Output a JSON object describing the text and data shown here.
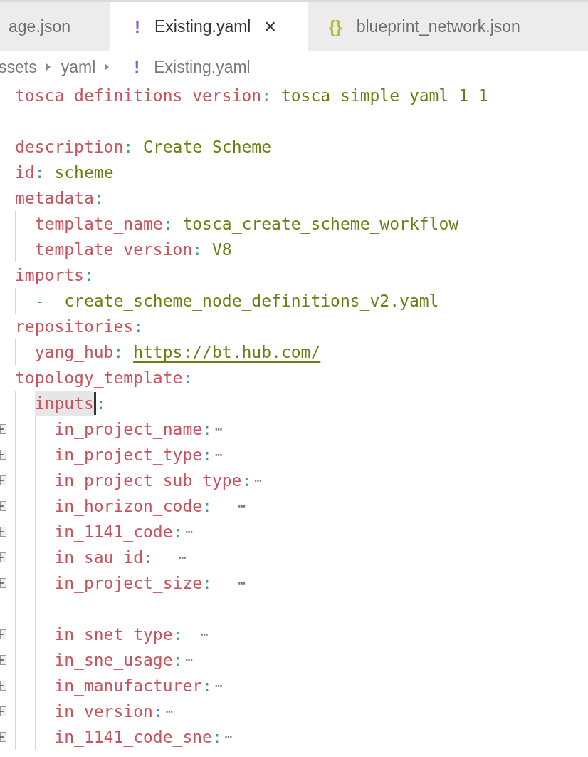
{
  "tabs": [
    {
      "label": "age.json",
      "selected": false
    },
    {
      "label": "Existing.yaml",
      "selected": true,
      "icon": "!",
      "color": "#8e5cc0",
      "close": "✕"
    },
    {
      "label": "blueprint_network.json",
      "selected": false,
      "icon": "{}",
      "color": "#b5ba3a"
    }
  ],
  "breadcrumb": [
    {
      "label": "ssets"
    },
    {
      "label": "yaml"
    },
    {
      "label": "Existing.yaml",
      "icon": "!",
      "color": "#8e5cc0"
    }
  ],
  "lines": [
    {
      "kind": "pair",
      "key": "tosca_definitions_version",
      "colon": ":",
      "value": "tosca_simple_yaml_1_1"
    },
    {
      "kind": "blank"
    },
    {
      "kind": "pair",
      "key": "description",
      "colon": ":",
      "value": "Create Scheme"
    },
    {
      "kind": "pair",
      "key": "id",
      "colon": ":",
      "value": "scheme"
    },
    {
      "kind": "pair",
      "key": "metadata",
      "colon": ":",
      "children": [
        {
          "kind": "pair",
          "key": "template_name",
          "colon": ":",
          "value": "tosca_create_scheme_workflow"
        },
        {
          "kind": "pair",
          "key": "template_version",
          "colon": ":",
          "value": "V8"
        }
      ]
    },
    {
      "kind": "pair",
      "key": "imports",
      "colon": ":",
      "children": [
        {
          "kind": "item",
          "marker": "-",
          "value": "create_scheme_node_definitions_v2.yaml"
        }
      ]
    },
    {
      "kind": "pair",
      "key": "repositories",
      "colon": ":",
      "children": [
        {
          "kind": "pair",
          "key": "yang_hub",
          "colon": ":",
          "value": "https://bt.hub.com/",
          "link": true
        }
      ]
    },
    {
      "kind": "pair",
      "key": "topology_template",
      "colon": ":",
      "children": [
        {
          "kind": "pair",
          "key": "inputs",
          "colon": ":",
          "highlighted": true,
          "cursor": true,
          "children": [
            {
              "kind": "pair",
              "key": "in_project_name",
              "colon": ":",
              "folded": true,
              "ellipsis": "⋯"
            },
            {
              "kind": "pair",
              "key": "in_project_type",
              "colon": ":",
              "folded": true,
              "ellipsis": "⋯"
            },
            {
              "kind": "pair",
              "key": "in_project_sub_type",
              "colon": ":",
              "folded": true,
              "ellipsis": "⋯"
            },
            {
              "kind": "pair",
              "key": "in_horizon_code",
              "colon": ":",
              "folded": true,
              "ellipsis": "   ⋯"
            },
            {
              "kind": "pair",
              "key": "in_1141_code",
              "colon": ":",
              "folded": true,
              "ellipsis": "⋯"
            },
            {
              "kind": "pair",
              "key": "in_sau_id",
              "colon": ":",
              "folded": true,
              "ellipsis": "   ⋯"
            },
            {
              "kind": "pair",
              "key": "in_project_size",
              "colon": ":",
              "folded": true,
              "ellipsis": "   ⋯"
            },
            {
              "kind": "blank"
            },
            {
              "kind": "pair",
              "key": "in_snet_type",
              "colon": ":",
              "folded": true,
              "ellipsis": "  ⋯"
            },
            {
              "kind": "pair",
              "key": "in_sne_usage",
              "colon": ":",
              "folded": true,
              "ellipsis": "⋯"
            },
            {
              "kind": "pair",
              "key": "in_manufacturer",
              "colon": ":",
              "folded": true,
              "ellipsis": "⋯"
            },
            {
              "kind": "pair",
              "key": "in_version",
              "colon": ":",
              "folded": true,
              "ellipsis": "⋯"
            },
            {
              "kind": "pair",
              "key": "in_1141_code_sne",
              "colon": ":",
              "folded": true,
              "ellipsis": "⋯"
            }
          ]
        }
      ]
    }
  ]
}
